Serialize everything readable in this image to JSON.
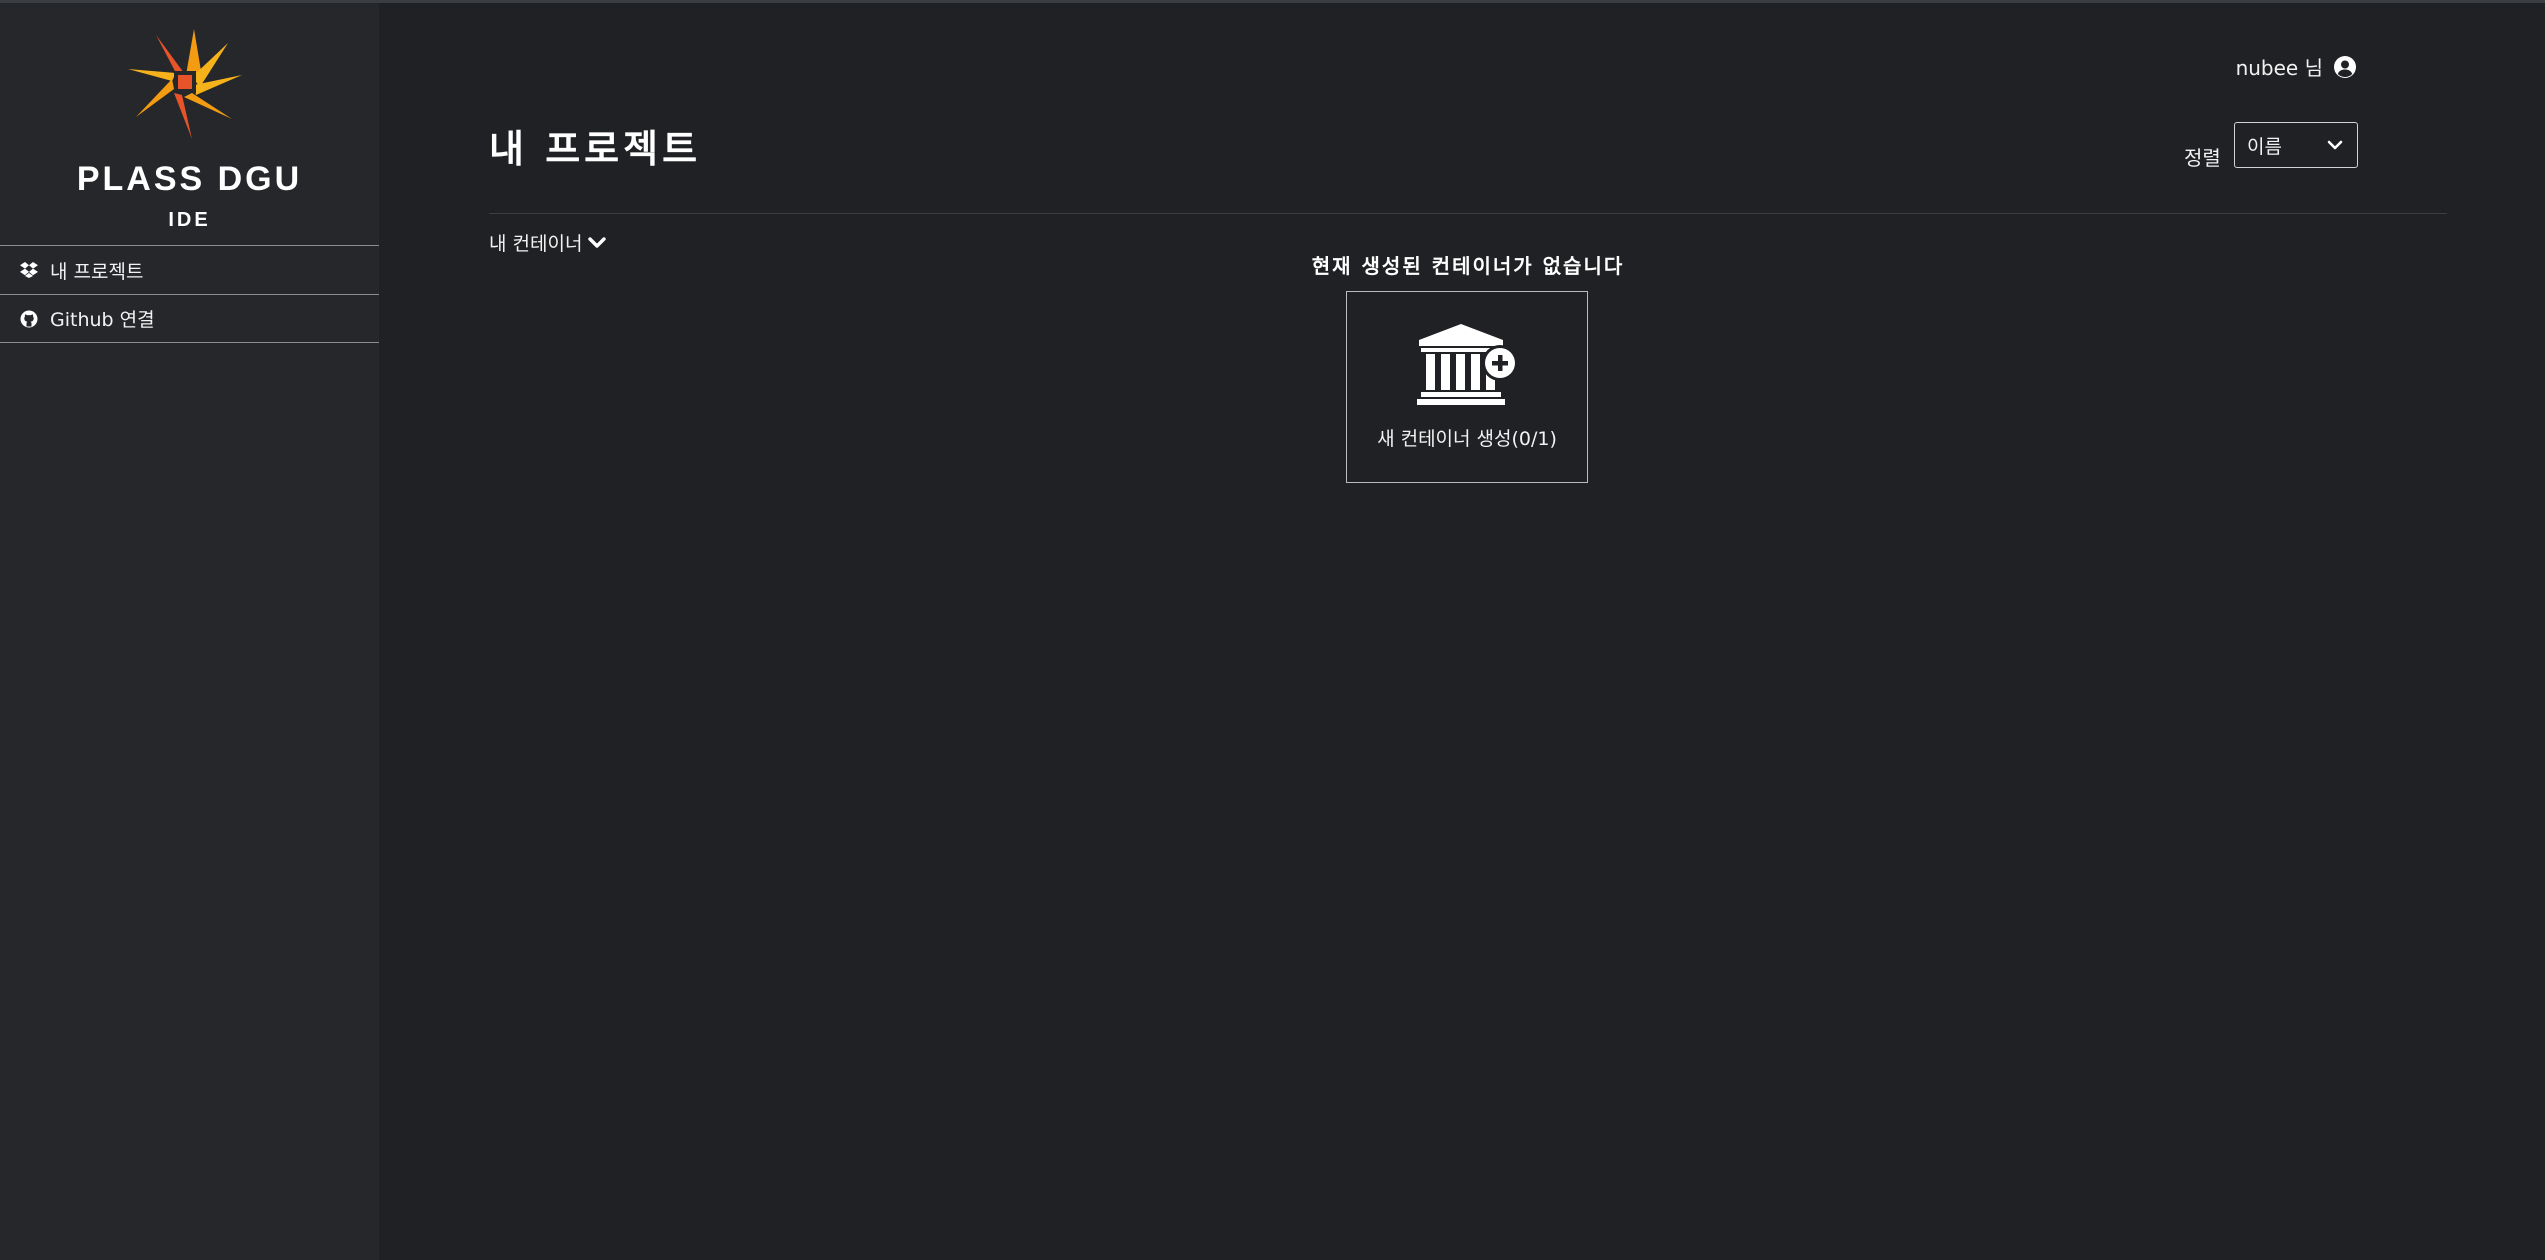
{
  "app": {
    "brand_name": "PLASS DGU",
    "brand_sub": "IDE",
    "colors": {
      "background": "#1f2124",
      "sidebar": "#25272b",
      "text": "#ffffff",
      "logo_orange": "#f39c12",
      "logo_red": "#e8542a"
    }
  },
  "sidebar": {
    "items": [
      {
        "label": "내 프로젝트",
        "icon": "dropbox-icon"
      },
      {
        "label": "Github 연결",
        "icon": "github-icon"
      }
    ]
  },
  "header": {
    "user_label": "nubee 님",
    "user_icon": "user-circle-icon"
  },
  "main": {
    "title": "내 프로젝트",
    "sort_label": "정렬",
    "sort_value": "이름",
    "section_label": "내 컨테이너",
    "empty_message": "현재 생성된 컨테이너가 없습니다",
    "new_container_label": "새 컨테이너 생성(0/1)",
    "new_container_icon": "university-plus-icon"
  }
}
